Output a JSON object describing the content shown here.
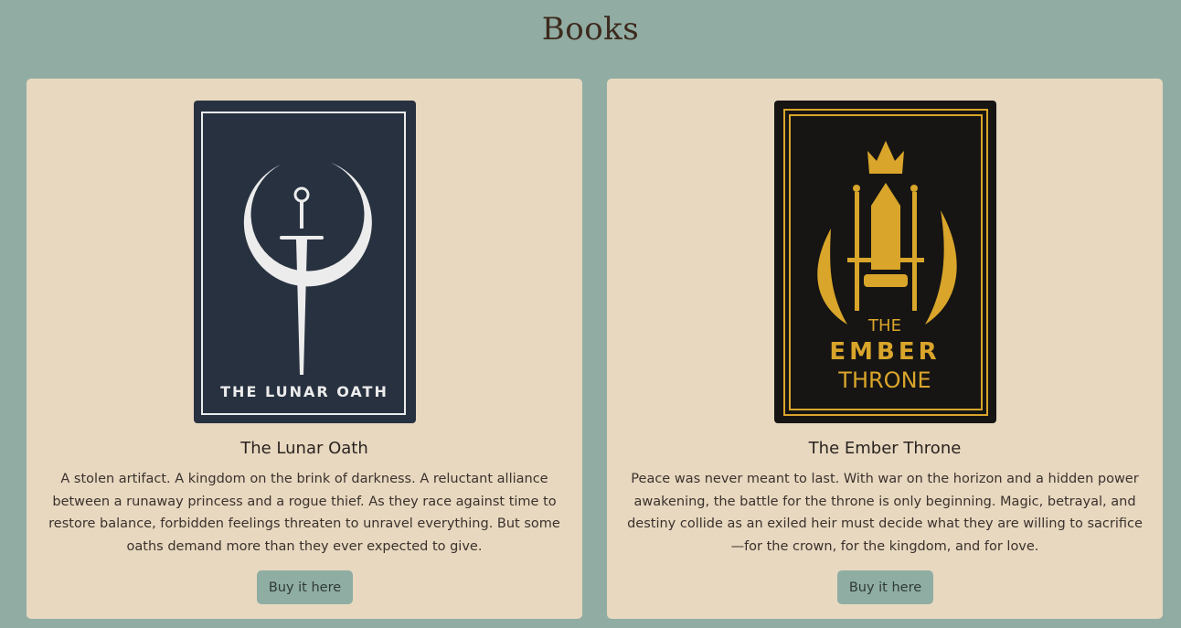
{
  "page_title": "Books",
  "books": [
    {
      "title": "The Lunar Oath",
      "cover_text": "THE LUNAR OATH",
      "cover_colors": {
        "bg": "#283140",
        "fg": "#ececec"
      },
      "description": "A stolen artifact. A kingdom on the brink of darkness. A reluctant alliance between a runaway princess and a rogue thief. As they race against time to restore balance, forbidden feelings threaten to unravel everything. But some oaths demand more than they ever expected to give.",
      "button_label": "Buy it here"
    },
    {
      "title": "The Ember Throne",
      "cover_text": [
        "THE",
        "EMBER",
        "THRONE"
      ],
      "cover_colors": {
        "bg": "#161514",
        "fg": "#d9a52a"
      },
      "description": "Peace was never meant to last. With war on the horizon and a hidden power awakening, the battle for the throne is only beginning. Magic, betrayal, and destiny collide as an exiled heir must decide what they are willing to sacrifice—for the crown, for the kingdom, and for love.",
      "button_label": "Buy it here"
    }
  ]
}
